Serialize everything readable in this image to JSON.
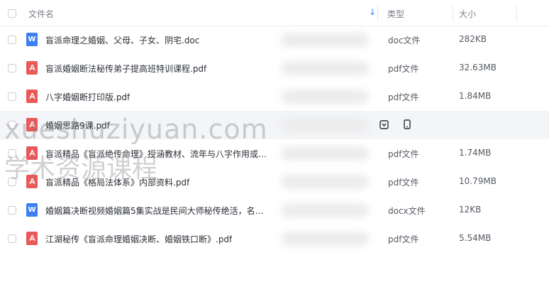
{
  "header": {
    "name_label": "文件名",
    "type_label": "类型",
    "size_label": "大小",
    "sort_icon": "sort-down-icon"
  },
  "files": [
    {
      "name": "盲派命理之婚姻、父母、子女、阴宅.doc",
      "type": "doc文件",
      "size": "282KB",
      "icon": "word-file-icon",
      "icon_letter": "W"
    },
    {
      "name": "盲派婚姻断法秘传弟子提高班特训课程.pdf",
      "type": "pdf文件",
      "size": "32.63MB",
      "icon": "pdf-file-icon",
      "icon_letter": "A"
    },
    {
      "name": "八字婚姻断打印版.pdf",
      "type": "pdf文件",
      "size": "1.84MB",
      "icon": "pdf-file-icon",
      "icon_letter": "A"
    },
    {
      "name": "婚姻思路9课.pdf",
      "type": "",
      "size": "",
      "icon": "pdf-file-icon",
      "icon_letter": "A"
    },
    {
      "name": "盲派精品《盲派绝传命理》授涵教材、流年与八字作用或…",
      "type": "pdf文件",
      "size": "1.74MB",
      "icon": "pdf-file-icon",
      "icon_letter": "A"
    },
    {
      "name": "盲派精品《格局法体系》内部资料.pdf",
      "type": "pdf文件",
      "size": "10.79MB",
      "icon": "pdf-file-icon",
      "icon_letter": "A"
    },
    {
      "name": "婚姻篇决断视频婚姻篇5集实战是民间大师秘传绝活，名…",
      "type": "docx文件",
      "size": "12KB",
      "icon": "word-file-icon",
      "icon_letter": "W"
    },
    {
      "name": "江湖秘传《盲派命理婚姻决断、婚姻铁口断》.pdf",
      "type": "pdf文件",
      "size": "5.54MB",
      "icon": "pdf-file-icon",
      "icon_letter": "A"
    }
  ],
  "hover_actions": [
    "save-to-disk-icon",
    "phone-icon"
  ],
  "watermark": {
    "line1": "xueshuziyuan.com",
    "line2": "学术资源课程"
  },
  "colors": {
    "word": "#3d7ff0",
    "pdf": "#e85a5a",
    "accent": "#3b7cff"
  }
}
